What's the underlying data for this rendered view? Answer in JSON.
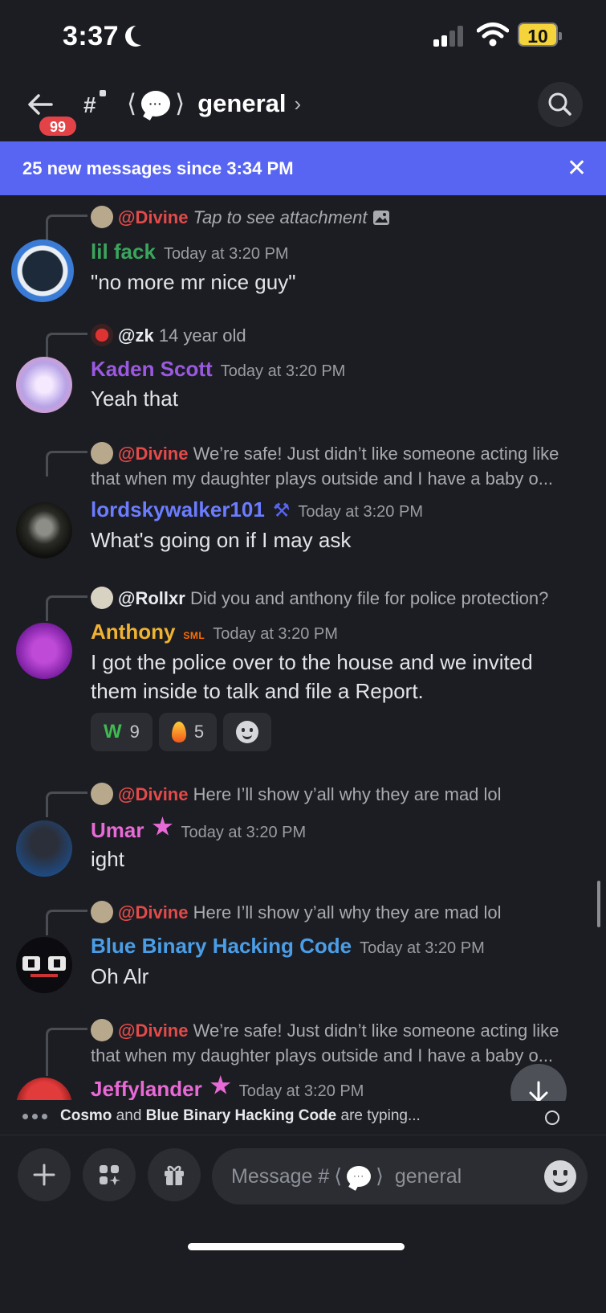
{
  "status_bar": {
    "time": "3:37",
    "battery": "10"
  },
  "header": {
    "unread_badge": "99",
    "channel_name": "general",
    "channel_open_paren": "⟨",
    "channel_close_paren": "⟩",
    "channel_bubble": "···",
    "chevron": "›"
  },
  "banner": {
    "text": "25 new messages since 3:34 PM",
    "close": "✕"
  },
  "messages": [
    {
      "reply_mention": "@Divine",
      "reply_text": "Tap to see attachment",
      "author": "lil fack",
      "author_color": "#3ba55d",
      "time": "Today at 3:20 PM",
      "body": "\"no more mr nice guy\""
    },
    {
      "reply_mention": "@zk",
      "reply_text": "14 year old",
      "author": "Kaden Scott",
      "author_color": "#9b59e0",
      "time": "Today at 3:20 PM",
      "body": "Yeah that"
    },
    {
      "reply_mention": "@Divine",
      "reply_text": "We’re safe! Just didn’t like someone acting like that when my daughter plays outside and I have a baby o...",
      "author": "lordskywalker101",
      "author_color": "#6b7cff",
      "time": "Today at 3:20 PM",
      "body": "What's going on if I may ask"
    },
    {
      "reply_mention": "@Rollxr",
      "reply_text": "Did you and anthony file for police protection?",
      "author": "Anthony",
      "author_color": "#f0b232",
      "role_tag": "SML",
      "time": "Today at 3:20 PM",
      "body": "I got the police over to the house and we invited them inside to talk and file a Report.",
      "reactions": [
        {
          "emoji": "W",
          "count": "9"
        },
        {
          "emoji": "fire",
          "count": "5"
        }
      ]
    },
    {
      "reply_mention": "@Divine",
      "reply_text": "Here I’ll show y’all why they are mad lol",
      "author": "Umar",
      "author_color": "#e86ad6",
      "time": "Today at 3:20 PM",
      "body": "ight"
    },
    {
      "reply_mention": "@Divine",
      "reply_text": "Here I’ll show y’all why they are mad lol",
      "author": "Blue Binary Hacking Code",
      "author_color": "#4a9ee8",
      "time": "Today at 3:20 PM",
      "body": "Oh Alr"
    },
    {
      "reply_mention": "@Divine",
      "reply_text": "We’re safe! Just didn’t like someone acting like that when my daughter plays outside and I have a baby o...",
      "author": "Jeffylander",
      "author_color": "#e86ad6",
      "time": "Today at 3:20 PM",
      "body": ""
    }
  ],
  "typing": {
    "user1": "Cosmo",
    "connector": " and ",
    "user2": "Blue Binary Hacking Code",
    "suffix": " are typing..."
  },
  "composer": {
    "placeholder_prefix": "Message #",
    "placeholder_channel": "general"
  }
}
